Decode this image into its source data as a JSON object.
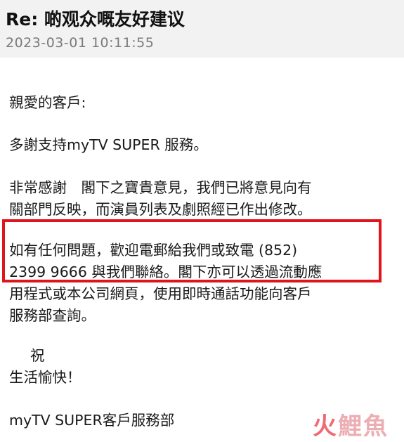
{
  "email": {
    "subject": "Re: 啲观众嘅友好建议",
    "datetime": "2023-03-01 10:11:55",
    "greeting": "親愛的客戶:",
    "thanks_line": "多謝支持myTV SUPER 服務。",
    "highlight_line_1": "非常感謝　閣下之寶貴意見，我們已將意見向有",
    "highlight_line_2": "關部門反映，而演員列表及劇照經已作出修改。",
    "contact_line_1": "如有任何問題，歡迎電郵給我們或致電 (852)",
    "contact_line_2": "2399 9666 與我們聯絡。閣下亦可以透過流動應",
    "contact_line_3": "用程式或本公司網頁，使用即時通話功能向客戶",
    "contact_line_4": "服務部查詢。",
    "closing_1": "祝",
    "closing_2": "生活愉快！",
    "signature": "myTV SUPER客戶服務部"
  },
  "watermark": {
    "part_1": "火",
    "part_2": "鯉魚"
  },
  "colors": {
    "highlight_border": "#e0151b",
    "date_text": "#7a7a7a",
    "header_bg": "#f2f2f2",
    "body_bg": "#ffffff"
  }
}
